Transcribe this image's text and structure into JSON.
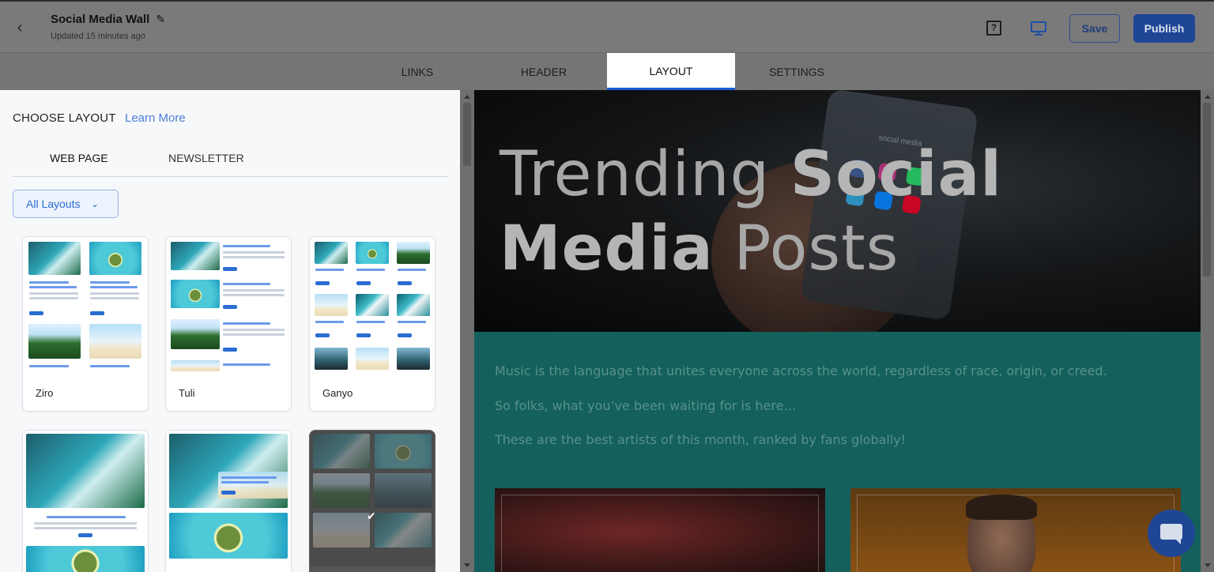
{
  "header": {
    "title": "Social Media Wall",
    "subtitle": "Updated 15 minutes ago",
    "help_glyph": "?",
    "save_label": "Save",
    "publish_label": "Publish"
  },
  "tabs": [
    {
      "label": "LINKS"
    },
    {
      "label": "HEADER"
    },
    {
      "label": "LAYOUT",
      "active": true
    },
    {
      "label": "SETTINGS"
    }
  ],
  "left": {
    "title": "CHOOSE LAYOUT",
    "learn_more": "Learn More",
    "subtabs": [
      {
        "label": "WEB PAGE",
        "active": true
      },
      {
        "label": "NEWSLETTER"
      }
    ],
    "dropdown_value": "All Layouts",
    "layouts": [
      {
        "name": "Ziro"
      },
      {
        "name": "Tuli"
      },
      {
        "name": "Ganyo"
      },
      {
        "name": ""
      },
      {
        "name": ""
      },
      {
        "name": "",
        "selected": true
      }
    ]
  },
  "preview": {
    "hero_title_part1": "Trending ",
    "hero_title_part2": "Social",
    "hero_title_part3": "Media",
    "hero_title_part4": " Posts",
    "phone_label": "social media",
    "paragraphs": [
      "Music is the language that unites everyone across the world, regardless of race, origin, or creed.",
      " So folks, what you’ve been waiting for is here…",
      "These are the best artists of this month, ranked by fans globally!"
    ]
  },
  "colors": {
    "accent": "#1e5bd7",
    "publish_bg": "#1f4595",
    "preview_body": "#13605c",
    "link": "#4a7fd6"
  }
}
